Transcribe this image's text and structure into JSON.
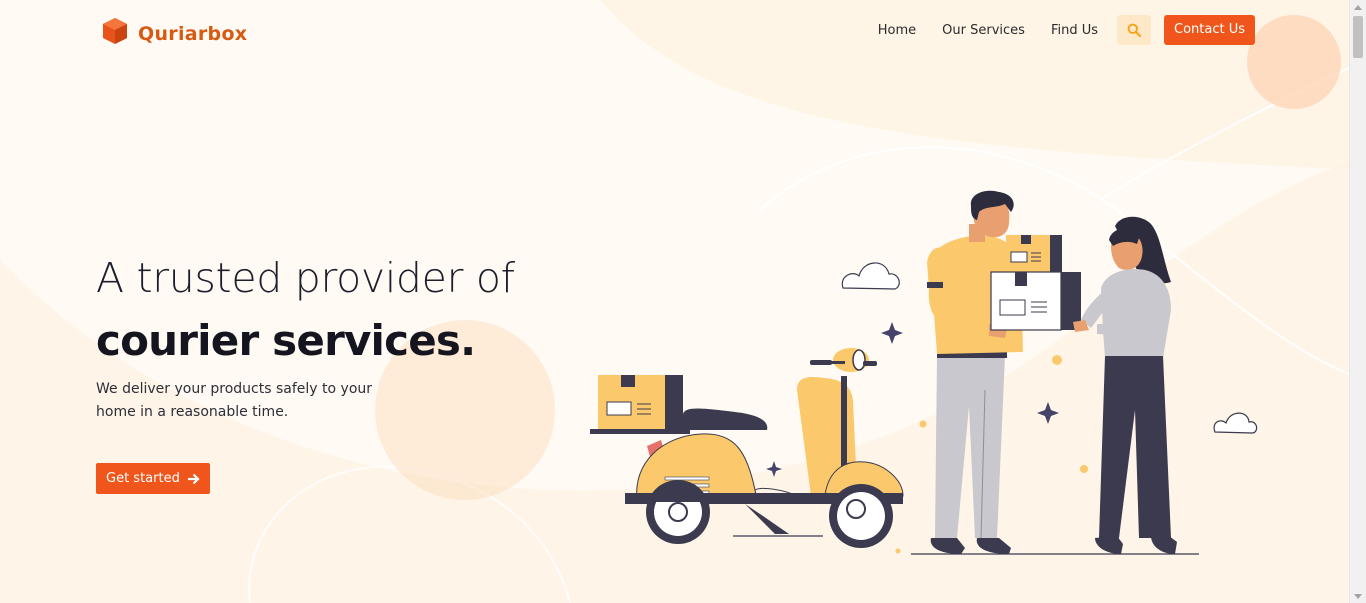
{
  "brand": {
    "name": "Quriarbox",
    "color": "#d85a12"
  },
  "nav": {
    "links": [
      {
        "label": "Home"
      },
      {
        "label": "Our Services"
      },
      {
        "label": "Find Us"
      }
    ],
    "search_icon": "search-icon",
    "contact_label": "Contact Us"
  },
  "hero": {
    "title_line1": "A trusted provider of",
    "title_line2": "courier services.",
    "subtitle": "We deliver your products safely to your home in a reasonable time.",
    "cta_label": "Get started",
    "cta_icon": "arrow-right-icon"
  },
  "colors": {
    "accent": "#f0561b",
    "illustration_yellow": "#fbc96b",
    "illustration_dark": "#3b3a4e",
    "background": "#fffbf4"
  }
}
